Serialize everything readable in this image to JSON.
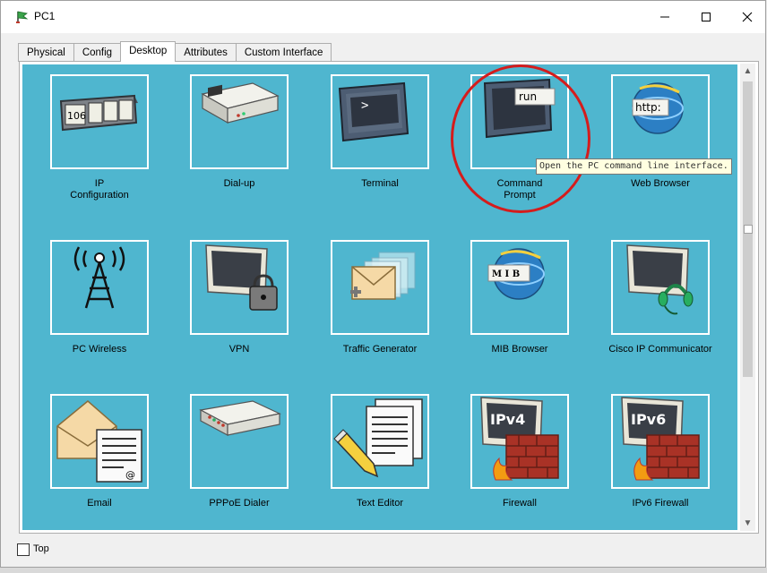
{
  "window": {
    "title": "PC1",
    "minimize_icon": "minimize-icon",
    "maximize_icon": "maximize-icon",
    "close_icon": "close-icon"
  },
  "tabs": [
    {
      "label": "Physical",
      "active": false
    },
    {
      "label": "Config",
      "active": false
    },
    {
      "label": "Desktop",
      "active": true
    },
    {
      "label": "Attributes",
      "active": false
    },
    {
      "label": "Custom Interface",
      "active": false
    }
  ],
  "desktop": {
    "apps": [
      {
        "label": "IP\nConfiguration",
        "icon": "ip-configuration-icon"
      },
      {
        "label": "Dial-up",
        "icon": "dial-up-modem-icon"
      },
      {
        "label": "Terminal",
        "icon": "terminal-monitor-icon"
      },
      {
        "label": "Command\nPrompt",
        "icon": "command-prompt-run-icon"
      },
      {
        "label": "Web Browser",
        "icon": "web-browser-globe-icon"
      },
      {
        "label": "PC Wireless",
        "icon": "wireless-tower-icon"
      },
      {
        "label": "VPN",
        "icon": "vpn-lock-monitor-icon"
      },
      {
        "label": "Traffic Generator",
        "icon": "traffic-generator-envelopes-icon"
      },
      {
        "label": "MIB Browser",
        "icon": "mib-browser-globe-icon"
      },
      {
        "label": "Cisco IP Communicator",
        "icon": "ip-communicator-headset-icon"
      },
      {
        "label": "Email",
        "icon": "email-envelope-icon"
      },
      {
        "label": "PPPoE Dialer",
        "icon": "pppoe-dialer-device-icon"
      },
      {
        "label": "Text Editor",
        "icon": "text-editor-pencil-icon"
      },
      {
        "label": "Firewall",
        "icon": "ipv4-firewall-icon"
      },
      {
        "label": "IPv6 Firewall",
        "icon": "ipv6-firewall-icon"
      }
    ],
    "icon_text": {
      "ip_box": "106",
      "run": "run",
      "http": "http:",
      "mib": "M I B",
      "ipv4": "IPv4",
      "ipv6": "IPv6",
      "at": "@",
      "prompt": ">"
    },
    "tooltip": "Open the PC command line interface.",
    "highlight_color": "#d51c1c",
    "background_color": "#4fb6cf"
  },
  "footer": {
    "top_checkbox_label": "Top",
    "top_checked": false
  }
}
